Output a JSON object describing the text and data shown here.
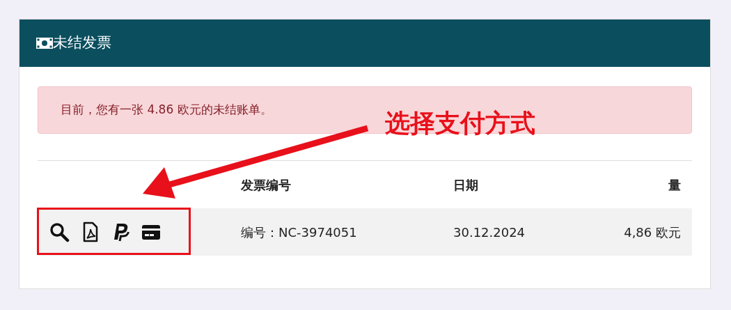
{
  "card": {
    "title": "未结发票"
  },
  "alert": {
    "text": "目前，您有一张 4.86 欧元的未结账单。"
  },
  "table": {
    "columns": [
      "发票编号",
      "日期",
      "量"
    ],
    "rows": [
      {
        "actions": [
          {
            "kind": "view"
          },
          {
            "kind": "pdf"
          },
          {
            "kind": "paypal"
          },
          {
            "kind": "card"
          }
        ],
        "cells": [
          "编号：NC-3974051",
          "30.12.2024",
          "4,86 欧元"
        ]
      }
    ]
  },
  "annotation": {
    "text": "选择支付方式"
  }
}
